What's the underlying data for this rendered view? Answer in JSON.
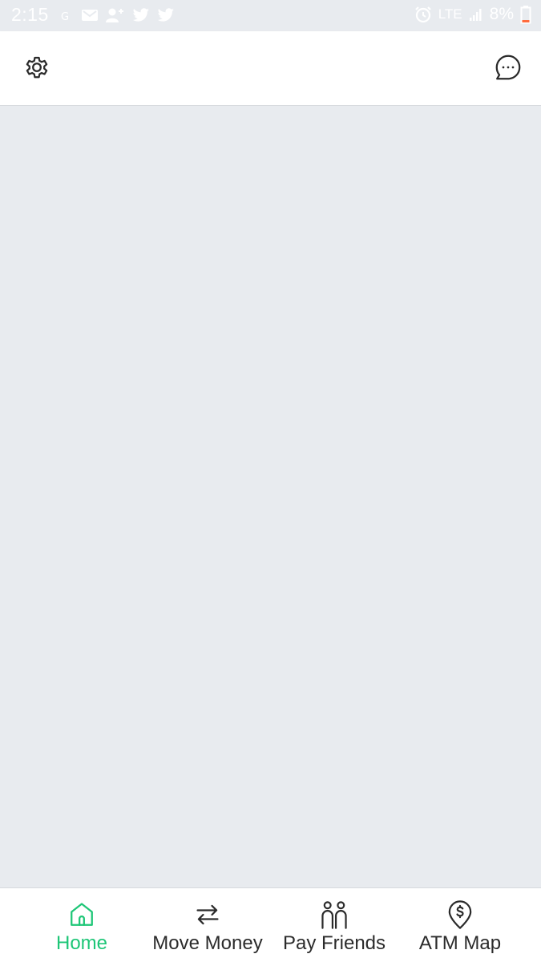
{
  "status_bar": {
    "time": "2:15",
    "network": "LTE",
    "battery": "8%",
    "battery_color": "#ff6b3d",
    "left_icons": [
      "signal-4g-icon",
      "gmail-icon",
      "add-contact-icon",
      "twitter-icon",
      "twitter-icon"
    ],
    "right_icons": [
      "alarm-icon",
      "lte-icon",
      "signal-bars-icon",
      "battery-icon"
    ]
  },
  "header": {
    "settings_icon": "gear-icon",
    "chat_icon": "chat-bubble-icon"
  },
  "bottom_nav": {
    "accent_color": "#1ec677",
    "items": [
      {
        "label": "Home",
        "icon": "home-icon",
        "active": true
      },
      {
        "label": "Move Money",
        "icon": "transfer-arrows-icon",
        "active": false
      },
      {
        "label": "Pay Friends",
        "icon": "people-icon",
        "active": false
      },
      {
        "label": "ATM Map",
        "icon": "map-pin-dollar-icon",
        "active": false
      }
    ]
  }
}
